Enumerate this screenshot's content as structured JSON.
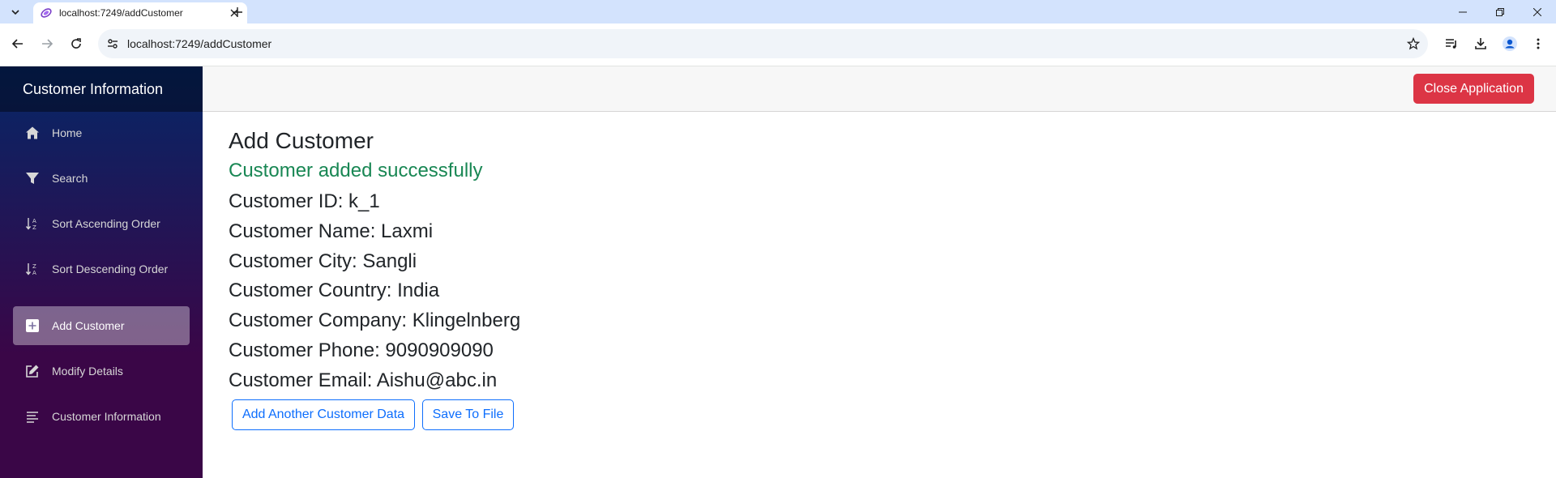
{
  "browser": {
    "tab_title": "localhost:7249/addCustomer",
    "url": "localhost:7249/addCustomer"
  },
  "app": {
    "brand": "Customer Information",
    "close_button": "Close Application",
    "nav": [
      {
        "label": "Home",
        "icon": "home-icon"
      },
      {
        "label": "Search",
        "icon": "filter-icon"
      },
      {
        "label": "Sort Ascending Order",
        "icon": "sort-ascending-icon"
      },
      {
        "label": "Sort Descending Order",
        "icon": "sort-descending-icon"
      },
      {
        "label": "Add Customer",
        "icon": "plus-square-icon",
        "active": true
      },
      {
        "label": "Modify Details",
        "icon": "edit-icon"
      },
      {
        "label": "Customer Information",
        "icon": "list-icon"
      }
    ]
  },
  "page": {
    "title": "Add Customer",
    "success_message": "Customer added successfully",
    "details": [
      "Customer ID: k_1",
      "Customer Name: Laxmi",
      "Customer City: Sangli",
      "Customer Country: India",
      "Customer Company: Klingelnberg",
      "Customer Phone: 9090909090",
      "Customer Email: Aishu@abc.in"
    ],
    "buttons": {
      "add_another": "Add Another Customer Data",
      "save_to_file": "Save To File"
    }
  },
  "colors": {
    "sidebar_top": "#052767",
    "sidebar_bottom": "#3a0647",
    "danger": "#dc3545",
    "success": "#198754",
    "primary": "#0d6efd"
  }
}
